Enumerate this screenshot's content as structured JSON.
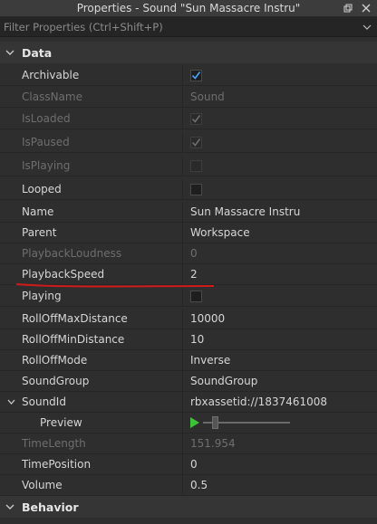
{
  "window": {
    "title": "Properties - Sound \"Sun Massacre Instru\""
  },
  "filter": {
    "placeholder": "Filter Properties (Ctrl+Shift+P)"
  },
  "sections": {
    "data": "Data",
    "behavior": "Behavior"
  },
  "properties": [
    {
      "name": "Archivable",
      "type": "checkbox",
      "checked": true,
      "disabled": false
    },
    {
      "name": "ClassName",
      "value": "Sound",
      "disabled": true
    },
    {
      "name": "IsLoaded",
      "type": "checkbox",
      "checked": true,
      "disabled": true
    },
    {
      "name": "IsPaused",
      "type": "checkbox",
      "checked": true,
      "disabled": true
    },
    {
      "name": "IsPlaying",
      "type": "checkbox",
      "checked": false,
      "disabled": true
    },
    {
      "name": "Looped",
      "type": "checkbox",
      "checked": false,
      "disabled": false
    },
    {
      "name": "Name",
      "value": "Sun Massacre Instru",
      "disabled": false
    },
    {
      "name": "Parent",
      "value": "Workspace",
      "disabled": false
    },
    {
      "name": "PlaybackLoudness",
      "value": "0",
      "disabled": true
    },
    {
      "name": "PlaybackSpeed",
      "value": "2",
      "disabled": false
    },
    {
      "name": "Playing",
      "type": "checkbox",
      "checked": false,
      "disabled": false
    },
    {
      "name": "RollOffMaxDistance",
      "value": "10000",
      "disabled": false
    },
    {
      "name": "RollOffMinDistance",
      "value": "10",
      "disabled": false
    },
    {
      "name": "RollOffMode",
      "value": "Inverse",
      "disabled": false
    },
    {
      "name": "SoundGroup",
      "value": "SoundGroup",
      "disabled": false
    },
    {
      "name": "SoundId",
      "value": "rbxassetid://1837461008",
      "disabled": false
    },
    {
      "name": "Preview",
      "type": "preview",
      "slider_level": 0.1
    },
    {
      "name": "TimeLength",
      "value": "151.954",
      "disabled": true
    },
    {
      "name": "TimePosition",
      "value": "0",
      "disabled": false
    },
    {
      "name": "Volume",
      "value": "0.5",
      "disabled": false
    }
  ],
  "colors": {
    "checkmark": "#4aa3ff",
    "annotation_underline": "#d11a1a",
    "play": "#3ec23e"
  }
}
